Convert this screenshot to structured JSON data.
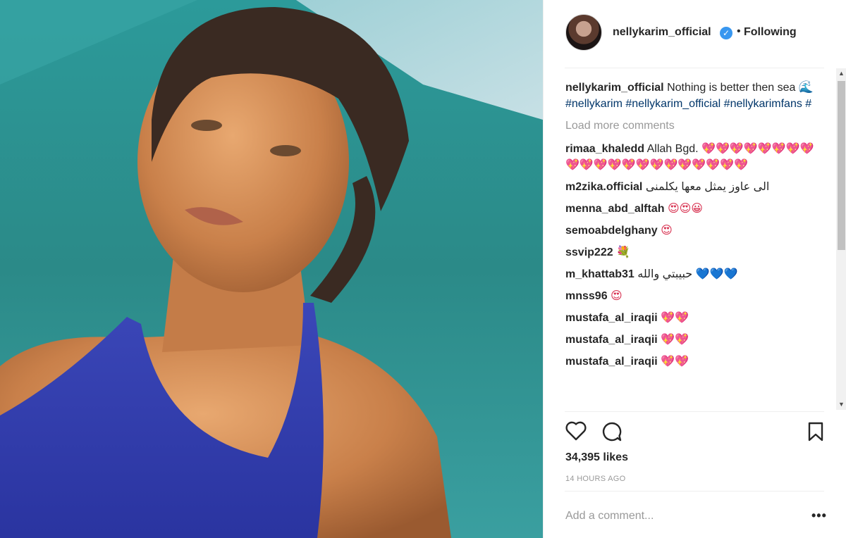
{
  "post": {
    "username": "nellykarim_official",
    "follow_status": "Following",
    "caption_parts": {
      "text": "Nothing is better then sea",
      "wave": "🌊",
      "tags": "#nellykarim #nellykarim_official #nellykarimfans #"
    },
    "load_more": "Load more comments",
    "likes": "34,395 likes",
    "time": "14 HOURS AGO",
    "add_comment_placeholder": "Add a comment...",
    "more_options": "•••"
  },
  "comments": [
    {
      "user": "rimaa_khaledd",
      "text": "Allah Bgd.",
      "emoji": "💖💖💖💖💖💖💖💖💖💖💖💖💖💖💖💖💖💖💖💖💖"
    },
    {
      "user": "m2zika.official",
      "text": "الى عاوز يمثل معها يكلمنى",
      "emoji": ""
    },
    {
      "user": "menna_abd_alftah",
      "text": "",
      "emoji": "😍😍😀"
    },
    {
      "user": "semoabdelghany",
      "text": "",
      "emoji": "😍"
    },
    {
      "user": "ssvip222",
      "text": "",
      "emoji": "💐"
    },
    {
      "user": "m_khattab31",
      "text": "حبيبتي والله",
      "emoji": "💙💙💙"
    },
    {
      "user": "mnss96",
      "text": "",
      "emoji": "😍"
    },
    {
      "user": "mustafa_al_iraqii",
      "text": "",
      "emoji": "💖💖"
    },
    {
      "user": "mustafa_al_iraqii",
      "text": "",
      "emoji": "💖💖"
    },
    {
      "user": "mustafa_al_iraqii",
      "text": "",
      "emoji": "💖💖"
    }
  ],
  "icons": {
    "like": "heart-outline-icon",
    "comment": "comment-bubble-icon",
    "save": "bookmark-icon",
    "verified": "verified-badge-icon"
  },
  "colors": {
    "accent_blue": "#3897f0",
    "hashtag": "#003569",
    "muted": "#999999"
  }
}
